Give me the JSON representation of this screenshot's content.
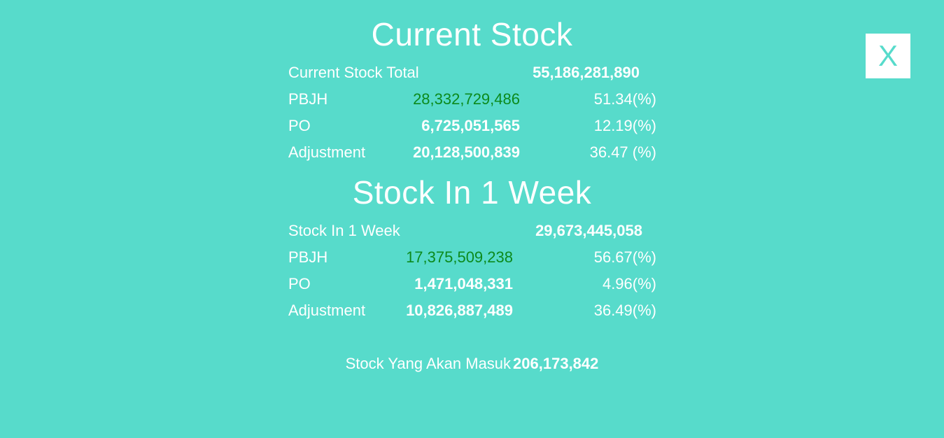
{
  "close_label": "X",
  "current_stock": {
    "title": "Current Stock",
    "total": {
      "label": "Current Stock Total",
      "value": "55,186,281,890"
    },
    "rows": [
      {
        "label": "PBJH",
        "value": "28,332,729,486",
        "pct": "51.34(%)"
      },
      {
        "label": "PO",
        "value": "6,725,051,565",
        "pct": "12.19(%)"
      },
      {
        "label": "Adjustment",
        "value": "20,128,500,839",
        "pct": "36.47 (%)"
      }
    ]
  },
  "stock_week": {
    "title": "Stock In 1 Week",
    "total": {
      "label": "Stock In 1 Week",
      "value": "29,673,445,058"
    },
    "rows": [
      {
        "label": "PBJH",
        "value": "17,375,509,238",
        "pct": "56.67(%)"
      },
      {
        "label": "PO",
        "value": "1,471,048,331",
        "pct": "4.96(%)"
      },
      {
        "label": "Adjustment",
        "value": "10,826,887,489",
        "pct": "36.49(%)"
      }
    ]
  },
  "incoming": {
    "label": "Stock Yang Akan Masuk",
    "value": "206,173,842"
  },
  "colors": {
    "background": "#57dbcb",
    "highlight": "#0c8a1c",
    "text": "#ffffff"
  }
}
